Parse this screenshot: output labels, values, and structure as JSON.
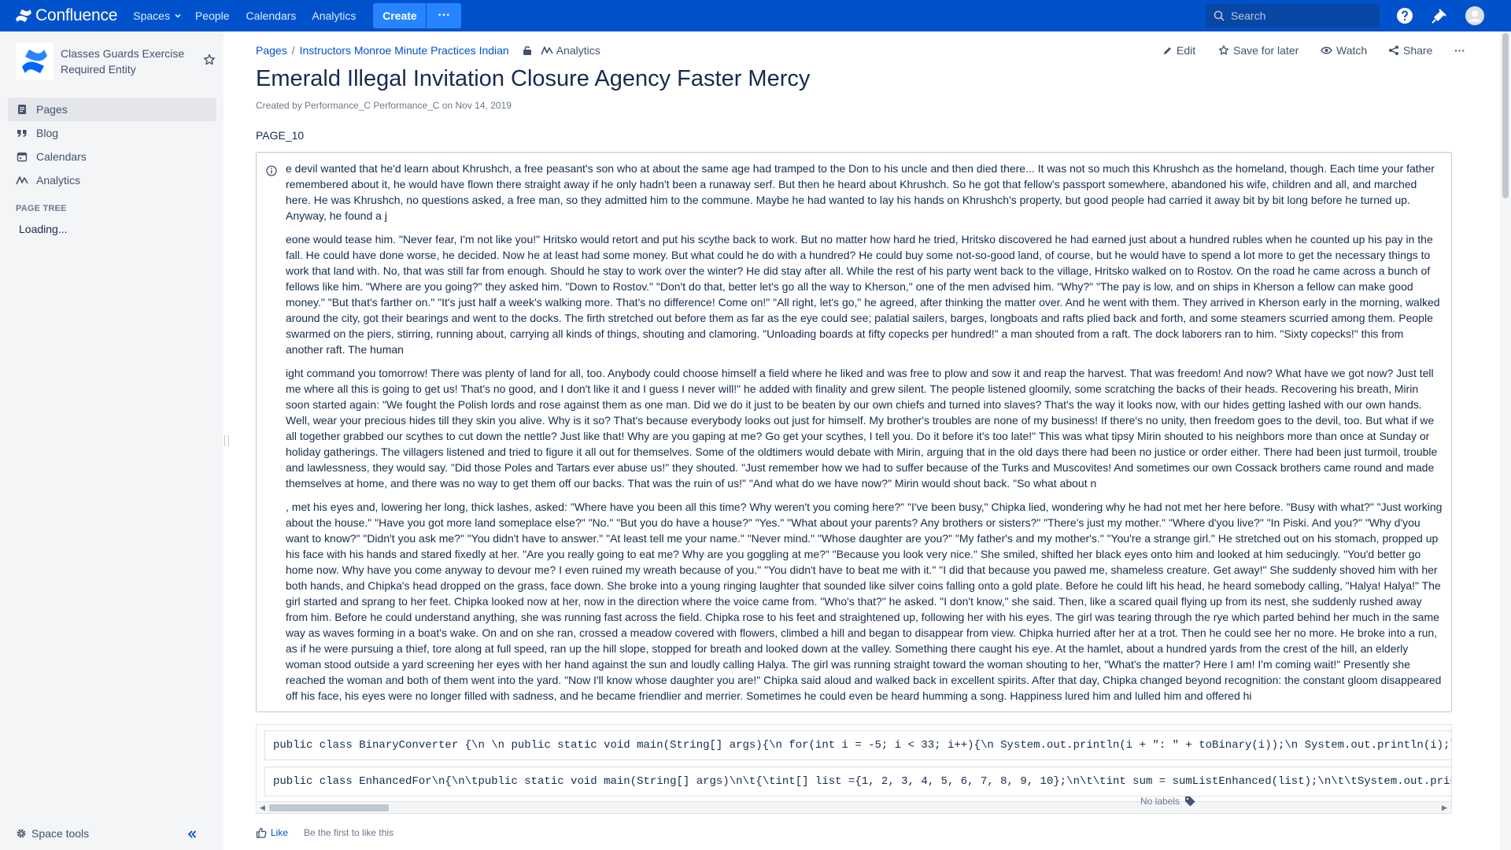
{
  "topnav": {
    "brand": "Confluence",
    "items": [
      "Spaces",
      "People",
      "Calendars",
      "Analytics"
    ],
    "create_label": "Create",
    "more_label": "···",
    "search_placeholder": "Search"
  },
  "sidebar": {
    "space_name": "Classes Guards Exercise Required Entity",
    "nav": [
      {
        "label": "Pages",
        "icon": "pages-icon"
      },
      {
        "label": "Blog",
        "icon": "blog-quote-icon"
      },
      {
        "label": "Calendars",
        "icon": "calendar-icon"
      },
      {
        "label": "Analytics",
        "icon": "analytics-icon"
      }
    ],
    "page_tree_title": "PAGE TREE",
    "loading": "Loading...",
    "space_tools": "Space tools"
  },
  "breadcrumbs": {
    "pages": "Pages",
    "separator": "/",
    "parent": "Instructors Monroe Minute Practices Indian",
    "analytics": "Analytics"
  },
  "actions": {
    "edit": "Edit",
    "save_for_later": "Save for later",
    "watch": "Watch",
    "share": "Share",
    "more": "···"
  },
  "page": {
    "title": "Emerald Illegal Invitation Closure Agency Faster Mercy",
    "byline_prefix": "Created by",
    "author": "Performance_C Performance_C",
    "byline_on": "on",
    "date": "Nov 14, 2019",
    "label": "PAGE_10"
  },
  "info_panel": {
    "paragraphs": [
      "e devil wanted that he'd learn about Khrushch, a free peasant's son who at about the same age had tramped to the Don to his uncle and then died there... It was not so much this Khrushch as the homeland, though. Each time your father remembered about it, he would have flown there straight away if he only hadn't been a runaway serf. But then he heard about Khrushch. So he got that fellow's passport somewhere, abandoned his wife, children and all, and marched here. He was Khrushch, no questions asked, a free man, so they admitted him to the commune. Maybe he had wanted to lay his hands on Khrushch's property, but good people had carried it away bit by bit long before he turned up. Anyway, he found a j",
      "eone would tease him. \"Never fear, I'm not like you!\" Hritsko would retort and put his scythe back to work. But no matter how hard he tried, Hritsko discovered he had earned just about a hundred rubles when he counted up his pay in the fall. He could have done worse, he decided. Now he at least had some money. But what could he do with a hundred? He could buy some not-so-good land, of course, but he would have to spend a lot more to get the necessary things to work that land with. No, that was still far from enough. Should he stay to work over the winter? He did stay after all. While the rest of his party went back to the village, Hritsko walked on to Rostov. On the road he came across a bunch of fellows like him. \"Where are you going?\" they asked him. \"Down to Rostov.\" \"Don't do that, better let's go all the way to Kherson,\" one of the men advised him. \"Why?\" \"The pay is low, and on ships in Kherson a fellow can make good money.\" \"But that's farther on.\" \"It's just half a week's walking more. That's no difference! Come on!\" \"All right, let's go,\" he agreed, after thinking the matter over. And he went with them. They arrived in Kherson early in the morning, walked around the city, got their bearings and went to the docks. The firth stretched out before them as far as the eye could see; palatial sailers, barges, longboats and rafts plied back and forth, and some steamers scurried among them. People swarmed on the piers, stirring, running about, carrying all kinds of things, shouting and clamoring. \"Unloading boards at fifty copecks per hundred!\" a man shouted from a raft. The dock laborers ran to him. \"Sixty copecks!\" this from another raft. The human",
      "ight command you tomorrow! There was plenty of land for all, too. Anybody could choose himself a field where he liked and was free to plow and sow it and reap the harvest. That was freedom! And now? What have we got now? Just tell me where all this is going to get us! That's no good, and I don't like it and I guess I never will!\" he added with finality and grew silent. The people listened gloomily, some scratching the backs of their heads. Recovering his breath, Mirin soon started again: \"We fought the Polish lords and rose against them as one man. Did we do it just to be beaten by our own chiefs and turned into slaves? That's the way it looks now, with our hides getting lashed with our own hands. Well, wear your precious hides till they skin you alive. Why is it so? That's because everybody looks out just for himself. My brother's troubles are none of my business! If there's no unity, then freedom goes to the devil, too. But what if we all together grabbed our scythes to cut down the nettle? Just like that! Why are you gaping at me? Go get your scythes, I tell you. Do it before it's too late!\" This was what tipsy Mirin shouted to his neighbors more than once at Sunday or holiday gatherings. The villagers listened and tried to figure it all out for themselves. Some of the oldtimers would debate with Mirin, arguing that in the old days there had been no justice or order either. There had been just turmoil, trouble and lawlessness, they would say. \"Did those Poles and Tartars ever abuse us!\" they shouted. \"Just remember how we had to suffer because of the Turks and Muscovites! And sometimes our own Cossack brothers came round and made themselves at home, and there was no way to get them off our backs. That was the ruin of us!\" \"And what do we have now?\" Mirin would shout back. \"So what about n",
      ", met his eyes and, lowering her long, thick lashes, asked: \"Where have you been all this time? Why weren't you coming here?\" \"I've been busy,\" Chipka lied, wondering why he had not met her here before. \"Busy with what?\" \"Just working about the house.\" \"Have you got more land someplace else?\" \"No.\" \"But you do have a house?\" \"Yes.\" \"What about your parents? Any brothers or sisters?\" \"There's just my mother.\" \"Where d'you live?\" \"In Piski. And you?\" \"Why d'you want to know?\" \"Didn't you ask me?\" \"You didn't have to answer.\" \"At least tell me your name.\" \"Never mind.\" \"Whose daughter are you?\" \"My father's and my mother's.\" \"You're a strange girl.\" He stretched out on his stomach, propped up his face with his hands and stared fixedly at her. \"Are you really going to eat me? Why are you goggling at me?\" \"Because you look very nice.\" She smiled, shifted her black eyes onto him and looked at him seducingly. \"You'd better go home now. Why have you come anyway to devour me? I even ruined my wreath because of you.\" \"You didn't have to beat me with it.\" \"I did that because you pawed me, shameless creature. Get away!\" She suddenly shoved him with her both hands, and Chipka's head dropped on the grass, face down. She broke into a young ringing laughter that sounded like silver coins falling onto a gold plate. Before he could lift his head, he heard somebody calling, \"Halya! Halya!\" The girl started and sprang to her feet. Chipka looked now at her, now in the direction where the voice came from. \"Who's that?\" he asked. \"I don't know,\" she said. Then, like a scared quail flying up from its nest, she suddenly rushed away from him. Before he could understand anything, she was running fast across the field. Chipka rose to his feet and straightened up, following her with his eyes. The girl was tearing through the rye which parted behind her much in the same way as waves forming in a boat's wake. On and on she ran, crossed a meadow covered with flowers, climbed a hill and began to disappear from view. Chipka hurried after her at a trot. Then he could see her no more. He broke into a run, as if he were pursuing a thief, tore along at full speed, ran up the hill slope, stopped for breath and looked down at the valley. Something there caught his eye. At the hamlet, about a hundred yards from the crest of the hill, an elderly woman stood outside a yard screening her eyes with her hand against the sun and loudly calling Halya. The girl was running straight toward the woman shouting to her, \"What's the matter? Here I am! I'm coming wait!\" Presently she reached the woman and both of them went into the yard. \"Now I'll know whose daughter you are!\" Chipka said aloud and walked back in excellent spirits. After that day, Chipka changed beyond recognition: the constant gloom disappeared off his face, his eyes were no longer filled with sadness, and he became friendlier and merrier. Sometimes he could even be heard humming a song. Happiness lured him and lulled him and offered hi"
    ]
  },
  "code_blocks": [
    "public class BinaryConverter {\\n \\n public static void main(String[] args){\\n for(int i = -5; i < 33; i++){\\n System.out.println(i + \": \" + toBinary(i));\\n System.out.println(i);\\n",
    "public class EnhancedFor\\n{\\n\\tpublic static void main(String[] args)\\n\\t{\\tint[] list ={1, 2, 3, 4, 5, 6, 7, 8, 9, 10};\\n\\t\\tint sum = sumListEnhanced(list);\\n\\t\\tSystem.out.println"
  ],
  "footer": {
    "like": "Like",
    "like_text": "Be the first to like this",
    "labels": "No labels"
  },
  "colors": {
    "topnav": "#0052cc",
    "create_button": "#2684ff",
    "sidebar": "#f4f5f7",
    "link": "#0052cc"
  }
}
